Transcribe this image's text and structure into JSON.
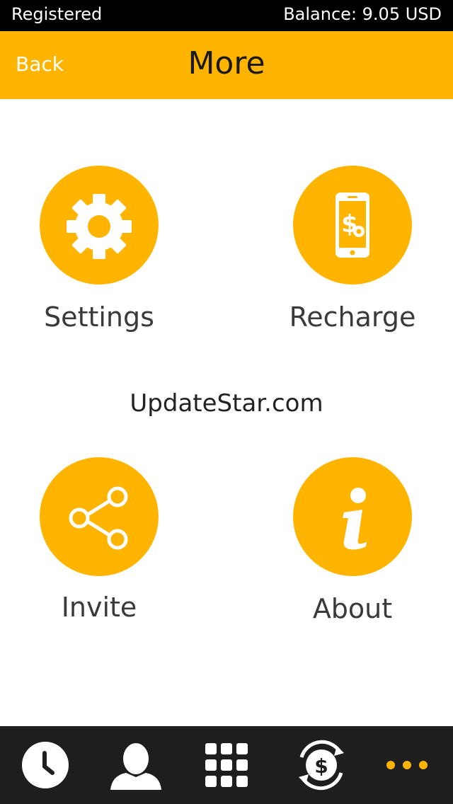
{
  "status_bar": {
    "left_text": "Registered",
    "right_text": "Balance: 9.05 USD"
  },
  "header": {
    "back_label": "Back",
    "title": "More"
  },
  "tiles": [
    {
      "label": "Settings",
      "icon": "gear-icon"
    },
    {
      "label": "Recharge",
      "icon": "phone-dollar-icon"
    },
    {
      "label": "Invite",
      "icon": "share-icon"
    },
    {
      "label": "About",
      "icon": "info-icon"
    }
  ],
  "watermark": "UpdateStar.com",
  "tabbar": {
    "tabs": [
      {
        "icon": "clock-icon"
      },
      {
        "icon": "person-icon"
      },
      {
        "icon": "dialpad-icon"
      },
      {
        "icon": "exchange-dollar-icon"
      },
      {
        "icon": "more-dots-icon",
        "active": true
      }
    ]
  },
  "colors": {
    "accent": "#ffb400",
    "status_bar_bg": "#000000",
    "tabbar_bg": "#1e1e1e",
    "text_dark": "#3a3a3a"
  }
}
